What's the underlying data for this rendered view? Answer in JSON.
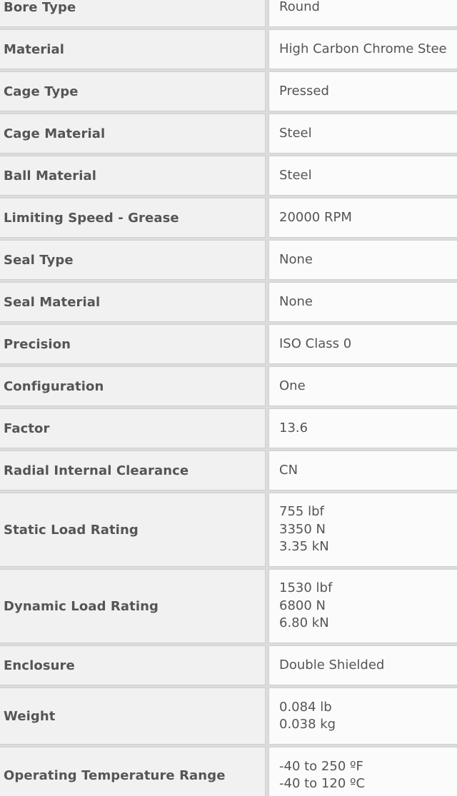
{
  "specs": [
    {
      "label": "Bore Type",
      "values": [
        "Round"
      ]
    },
    {
      "label": "Material",
      "values": [
        "High Carbon Chrome Stee"
      ]
    },
    {
      "label": "Cage Type",
      "values": [
        "Pressed"
      ]
    },
    {
      "label": "Cage Material",
      "values": [
        "Steel"
      ]
    },
    {
      "label": "Ball Material",
      "values": [
        "Steel"
      ]
    },
    {
      "label": "Limiting Speed - Grease",
      "values": [
        "20000 RPM"
      ]
    },
    {
      "label": "Seal Type",
      "values": [
        "None"
      ]
    },
    {
      "label": "Seal Material",
      "values": [
        "None"
      ]
    },
    {
      "label": "Precision",
      "values": [
        "ISO Class 0"
      ]
    },
    {
      "label": "Configuration",
      "values": [
        "One"
      ]
    },
    {
      "label": "Factor",
      "values": [
        "13.6"
      ]
    },
    {
      "label": "Radial Internal Clearance",
      "values": [
        "CN"
      ]
    },
    {
      "label": "Static Load Rating",
      "values": [
        "755 lbf",
        "3350 N",
        "3.35 kN"
      ]
    },
    {
      "label": "Dynamic Load Rating",
      "values": [
        "1530 lbf",
        "6800 N",
        "6.80 kN"
      ]
    },
    {
      "label": "Enclosure",
      "values": [
        "Double Shielded"
      ]
    },
    {
      "label": "Weight",
      "values": [
        "0.084 lb",
        "0.038 kg"
      ]
    },
    {
      "label": "Operating Temperature Range",
      "values": [
        "-40 to 250 ºF",
        "-40 to 120 ºC"
      ]
    }
  ]
}
